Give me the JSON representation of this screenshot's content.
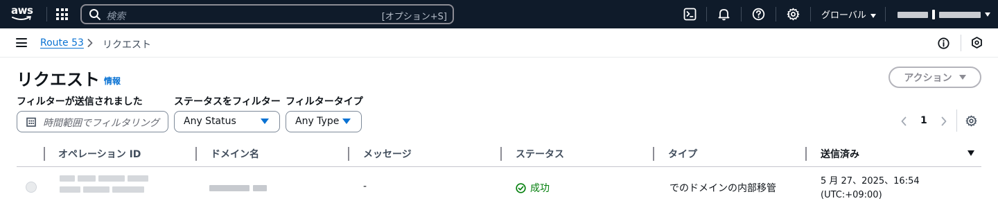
{
  "topbar": {
    "logo_text": "aws",
    "search_placeholder": "検索",
    "search_shortcut": "[オプション+S]",
    "region_label": "グローバル",
    "icons": [
      "cloudshell-icon",
      "bell-icon",
      "help-icon",
      "gear-icon"
    ]
  },
  "breadcrumb": {
    "parent": "Route 53",
    "current": "リクエスト"
  },
  "header": {
    "title": "リクエスト",
    "info_link": "情報",
    "actions_label": "アクション"
  },
  "filters": {
    "date_label": "フィルターが送信されました",
    "date_placeholder": "時間範囲でフィルタリング",
    "status_label": "ステータスをフィルター",
    "status_value": "Any Status",
    "type_label": "フィルタータイプ",
    "type_value": "Any Type"
  },
  "pagination": {
    "current_page": "1"
  },
  "table": {
    "columns": [
      "オペレーション ID",
      "ドメイン名",
      "メッセージ",
      "ステータス",
      "タイプ",
      "送信済み"
    ],
    "rows": [
      {
        "message": "-",
        "status": "成功",
        "type": "でのドメインの内部移管",
        "sent_line1": "5 月 27、2025、16:54",
        "sent_line2": "(UTC:+09:00)"
      }
    ]
  },
  "colors": {
    "nav_bg": "#0f1b2a",
    "link": "#0972d3",
    "success": "#037f0c"
  }
}
